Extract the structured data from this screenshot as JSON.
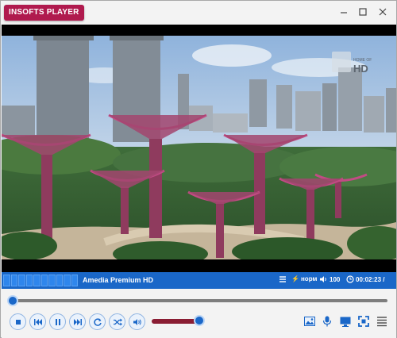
{
  "app": {
    "logo_text": "INSOFTS PLAYER",
    "minimize_icon": "minimize-icon",
    "maximize_icon": "maximize-icon",
    "close_icon": "close-icon"
  },
  "video": {
    "watermark": "HOME OF",
    "watermark_big": "HD"
  },
  "status": {
    "track_title": "Amedia Premium HD",
    "mode_label": "норм",
    "volume_label": "100",
    "time_label": "00:02:23 /"
  },
  "playback": {
    "progress_fraction": 0.0,
    "volume_fraction": 1.0
  },
  "controls": {
    "left": [
      "stop-icon",
      "previous-icon",
      "pause-icon",
      "next-icon",
      "repeat-icon",
      "shuffle-icon",
      "volume-icon"
    ],
    "right": [
      "picture-icon",
      "microphone-icon",
      "screen-icon",
      "fullscreen-icon",
      "playlist-icon"
    ]
  },
  "colors": {
    "brand": "#b01a4e",
    "accent_blue": "#1a67c8",
    "volume_track": "#8a1d33"
  }
}
